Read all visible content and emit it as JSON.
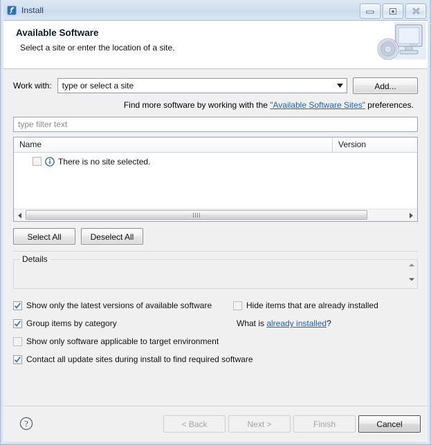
{
  "window": {
    "title": "Install",
    "icon": "eclipse-install-icon",
    "buttons": {
      "minimize": "minimize-icon",
      "maximize": "maximize-icon",
      "close": "close-icon"
    }
  },
  "header": {
    "title": "Available Software",
    "subtitle": "Select a site or enter the location of a site.",
    "graphic": "monitor-with-disc-icon"
  },
  "work_with": {
    "label": "Work with:",
    "value": "type or select a site",
    "placeholder": "type or select a site",
    "add_button": "Add...",
    "dropdown_icon": "chevron-down-icon"
  },
  "find_more": {
    "prefix": "Find more software by working with the ",
    "link": "\"Available Software Sites\"",
    "suffix": " preferences."
  },
  "filter": {
    "placeholder": "type filter text",
    "value": ""
  },
  "table": {
    "columns": [
      "Name",
      "Version"
    ],
    "rows": [
      {
        "checked": false,
        "icon": "info-icon",
        "name": "There is no site selected.",
        "version": ""
      }
    ],
    "hscroll": {
      "left_arrow": "triangle-left-icon",
      "right_arrow": "triangle-right-icon",
      "grip": "grip-icon"
    }
  },
  "selection_buttons": {
    "select_all": "Select All",
    "deselect_all": "Deselect All"
  },
  "details": {
    "legend": "Details",
    "text": "",
    "scroll_up": "spinner-up-icon",
    "scroll_down": "spinner-down-icon"
  },
  "options": {
    "left": [
      {
        "label": "Show only the latest versions of available software",
        "checked": true
      },
      {
        "label": "Group items by category",
        "checked": true
      },
      {
        "label": "Show only software applicable to target environment",
        "checked": false
      },
      {
        "label": "Contact all update sites during install to find required software",
        "checked": true
      }
    ],
    "right": [
      {
        "label": "Hide items that are already installed",
        "checked": true,
        "state": "unchecked"
      }
    ],
    "what_is": {
      "prefix": "What is ",
      "link": "already installed",
      "suffix": "?"
    }
  },
  "footer": {
    "help_icon": "help-question-icon",
    "buttons": [
      {
        "label": "< Back",
        "state": "disabled"
      },
      {
        "label": "Next >",
        "state": "disabled"
      },
      {
        "label": "Finish",
        "state": "disabled"
      },
      {
        "label": "Cancel",
        "state": "default"
      }
    ]
  },
  "colors": {
    "link": "#1f5fbf",
    "title_text": "#12315a",
    "dialog_bg": "#f0f0f0",
    "frame": "#a8bad0",
    "check": "#2e6ec0"
  }
}
